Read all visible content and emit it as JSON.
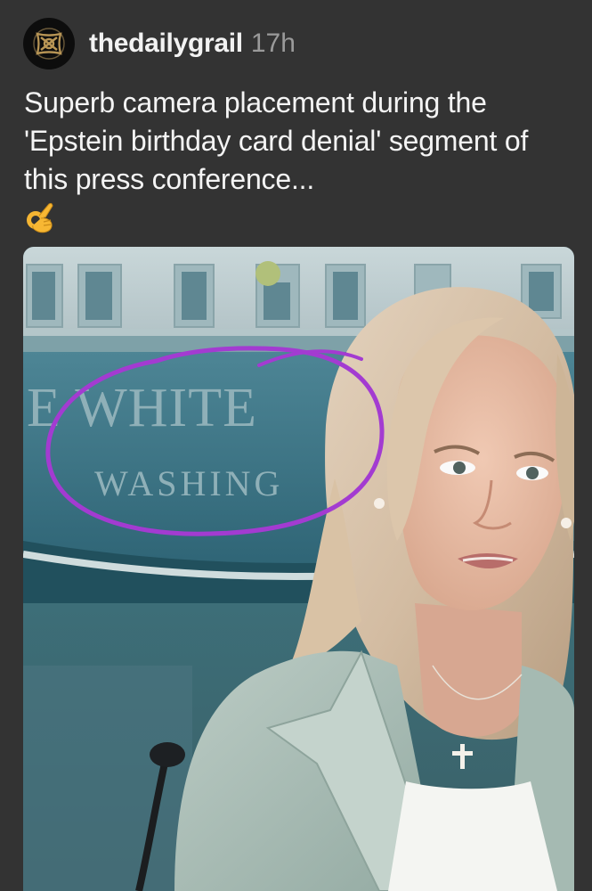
{
  "post": {
    "username": "thedailygrail",
    "timestamp": "17h",
    "caption": "Superb camera placement during the 'Epstein birthday card denial' segment of this press conference...",
    "emoji": "ok-hand-emoji"
  },
  "media": {
    "sign_line1": "E WHITE",
    "sign_line2": "WASHING",
    "annotation_color": "#a33bd1"
  },
  "colors": {
    "background": "#333333",
    "username": "#f2f2f2",
    "timestamp": "#9a9a9a",
    "emoji": "#f7b733"
  }
}
